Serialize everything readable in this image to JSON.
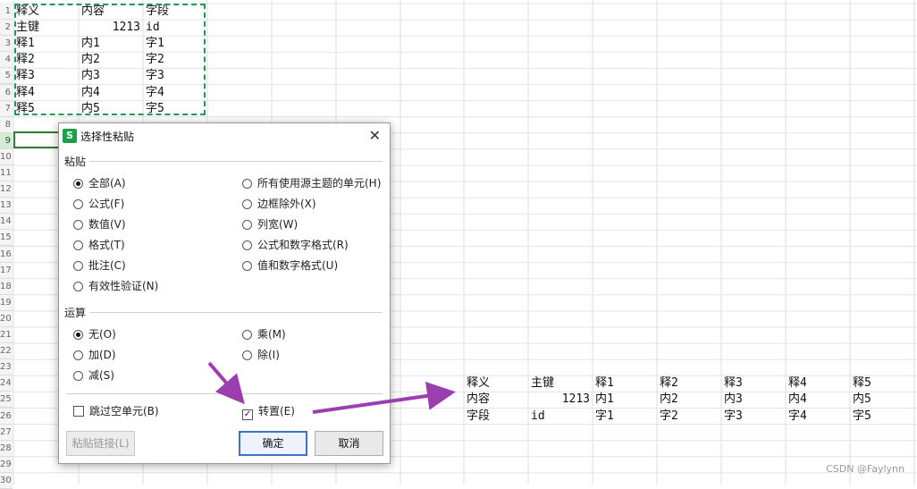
{
  "spreadsheet": {
    "row_headers": [
      "1",
      "2",
      "3",
      "4",
      "5",
      "6",
      "7",
      "8",
      "9",
      "10",
      "11",
      "12",
      "13",
      "14",
      "15",
      "16",
      "17",
      "18",
      "19",
      "20",
      "21",
      "22",
      "23",
      "24",
      "25",
      "26",
      "27",
      "28",
      "29",
      "30"
    ],
    "source_table": [
      [
        "释义",
        "内容",
        "字段"
      ],
      [
        "主键",
        "1213",
        "id"
      ],
      [
        "释1",
        "内1",
        "字1"
      ],
      [
        "释2",
        "内2",
        "字2"
      ],
      [
        "释3",
        "内3",
        "字3"
      ],
      [
        "释4",
        "内4",
        "字4"
      ],
      [
        "释5",
        "内5",
        "字5"
      ]
    ],
    "transposed_table": [
      [
        "释义",
        "主键",
        "释1",
        "释2",
        "释3",
        "释4",
        "释5"
      ],
      [
        "内容",
        "1213",
        "内1",
        "内2",
        "内3",
        "内4",
        "内5"
      ],
      [
        "字段",
        "id",
        "字1",
        "字2",
        "字3",
        "字4",
        "字5"
      ]
    ]
  },
  "dialog": {
    "logo": "S",
    "title": "选择性粘贴",
    "close_icon": "close-icon",
    "paste_section": "粘贴",
    "paste_options_left": [
      {
        "label": "全部(A)",
        "selected": true
      },
      {
        "label": "公式(F)",
        "selected": false
      },
      {
        "label": "数值(V)",
        "selected": false
      },
      {
        "label": "格式(T)",
        "selected": false
      },
      {
        "label": "批注(C)",
        "selected": false
      },
      {
        "label": "有效性验证(N)",
        "selected": false
      }
    ],
    "paste_options_right": [
      {
        "label": "所有使用源主题的单元(H)",
        "selected": false
      },
      {
        "label": "边框除外(X)",
        "selected": false
      },
      {
        "label": "列宽(W)",
        "selected": false
      },
      {
        "label": "公式和数字格式(R)",
        "selected": false
      },
      {
        "label": "值和数字格式(U)",
        "selected": false
      }
    ],
    "operation_section": "运算",
    "operation_options_left": [
      {
        "label": "无(O)",
        "selected": true
      },
      {
        "label": "加(D)",
        "selected": false
      },
      {
        "label": "减(S)",
        "selected": false
      }
    ],
    "operation_options_right": [
      {
        "label": "乘(M)",
        "selected": false
      },
      {
        "label": "除(I)",
        "selected": false
      }
    ],
    "skip_blanks": {
      "label": "跳过空单元(B)",
      "checked": false
    },
    "transpose": {
      "label": "转置(E)",
      "checked": true
    },
    "buttons": {
      "paste_link": "粘贴链接(L)",
      "ok": "确定",
      "cancel": "取消"
    }
  },
  "annotation_color": "#9b3fb0",
  "watermark": "CSDN @Faylynn"
}
